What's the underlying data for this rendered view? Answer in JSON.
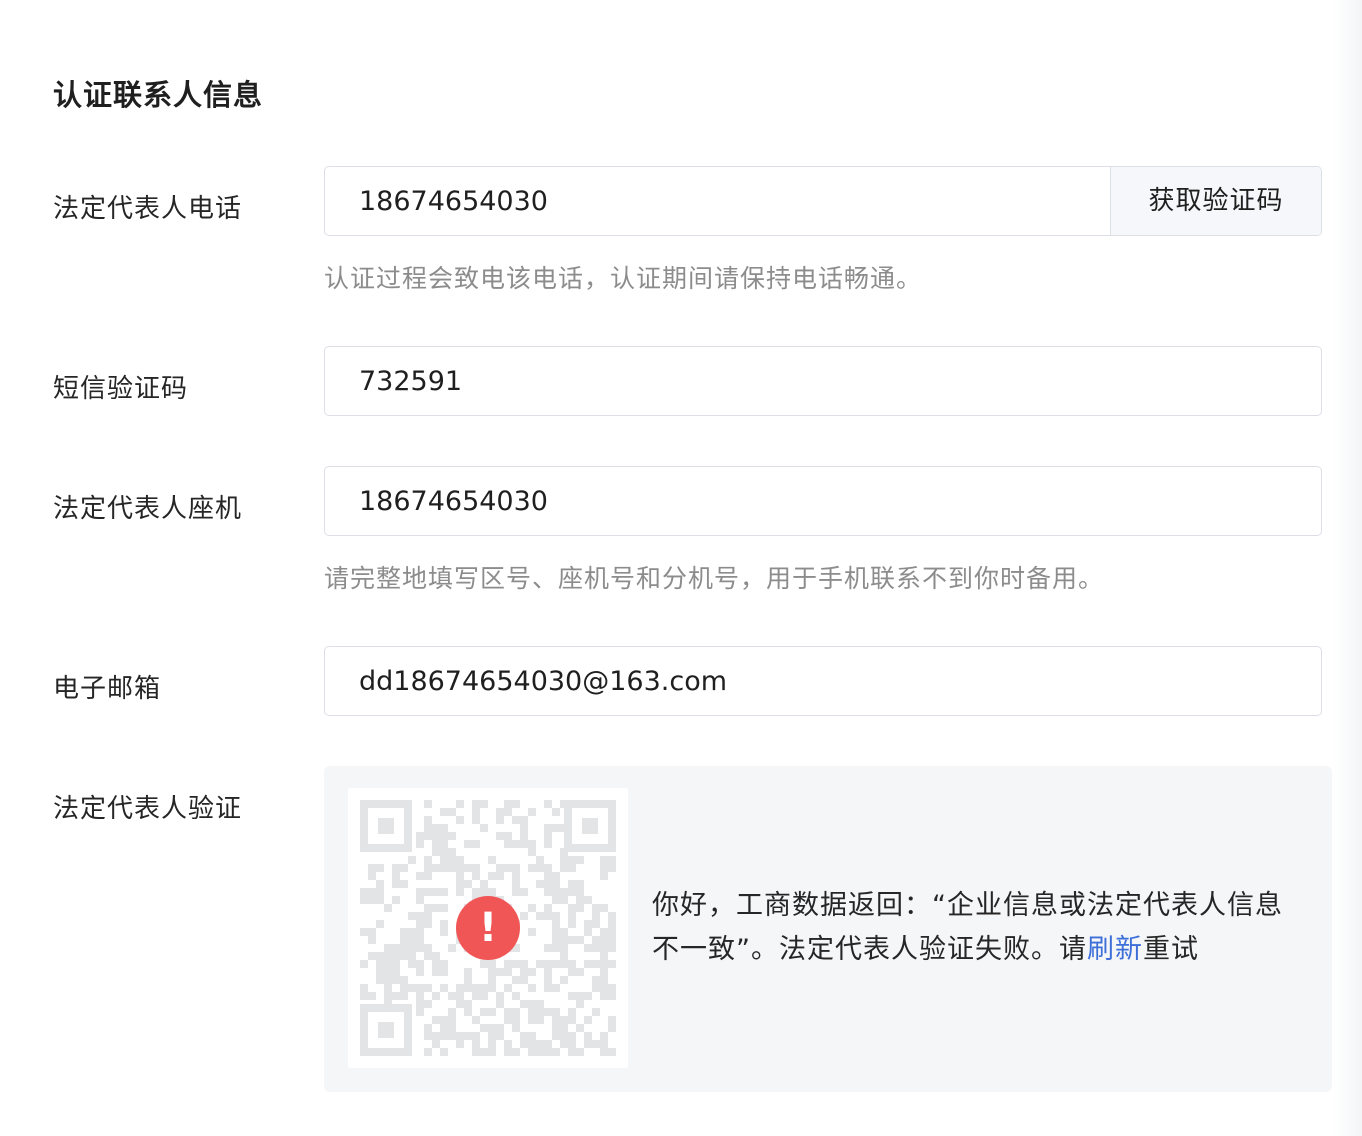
{
  "section": {
    "title": "认证联系人信息"
  },
  "phone": {
    "label": "法定代表人电话",
    "value": "18674654030",
    "button_label": "获取验证码",
    "hint": "认证过程会致电该电话，认证期间请保持电话畅通。"
  },
  "sms": {
    "label": "短信验证码",
    "value": "732591"
  },
  "landline": {
    "label": "法定代表人座机",
    "value": "18674654030",
    "hint": "请完整地填写区号、座机号和分机号，用于手机联系不到你时备用。"
  },
  "email": {
    "label": "电子邮箱",
    "value": "dd18674654030@163.com"
  },
  "verification": {
    "label": "法定代表人验证",
    "error_icon": "!",
    "message_before": "你好，工商数据返回：“企业信息或法定代表人信息不一致”。法定代表人验证失败。请",
    "link_text": "刷新",
    "message_after": "重试"
  },
  "colors": {
    "error": "#f05656",
    "link": "#3d6fd8",
    "hint": "#8c8c8c",
    "border": "#dcdfe6",
    "panel_bg": "#f5f6f8"
  },
  "icons": {
    "error": "error-icon",
    "qr": "qr-code-icon"
  }
}
